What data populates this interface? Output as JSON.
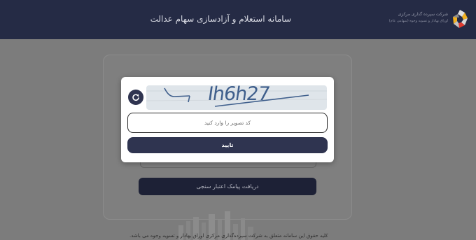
{
  "header": {
    "title": "سامانه استعلام و آزادسازی سهام عدالت",
    "logo_line1": "شرکت سپرده گذاری مرکزی",
    "logo_line2": "اوراق بهادار و تسویه وجوه (سهامی عام)"
  },
  "background": {
    "sms_button_label": "دریافت پیامک اعتبار سنجی",
    "footer_text": "کلیه حقوق این سامانه متعلق به شرکت سپرده‌گذاری مرکزی اوراق بهادار و تسویه وجوه می باشد."
  },
  "modal": {
    "captcha_text": "Ih6h27",
    "refresh_icon": "refresh-icon",
    "input_placeholder": "کد تصویر را وارد کنید",
    "input_value": "",
    "submit_label": "تایید"
  },
  "colors": {
    "header_bg": "#252b45",
    "button_bg": "#2f3450",
    "overlay": "#7c7c7c"
  }
}
